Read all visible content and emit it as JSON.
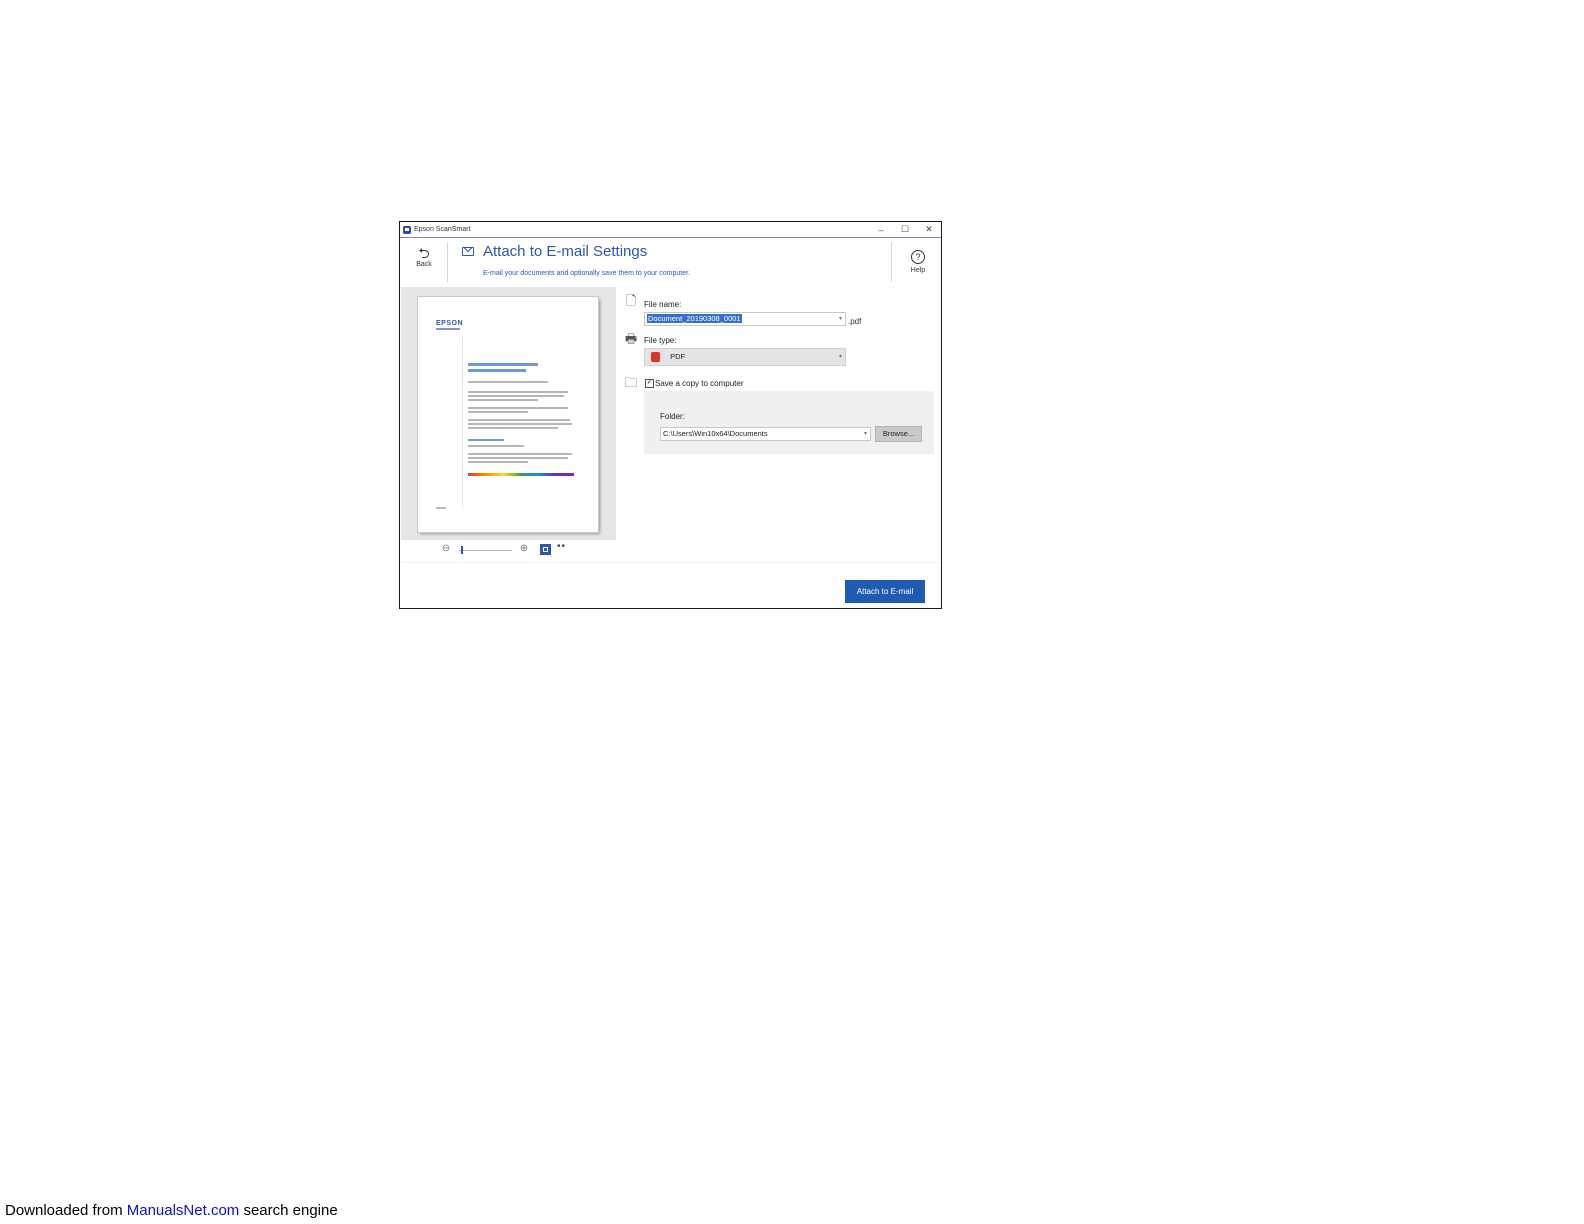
{
  "window": {
    "title": "Epson ScanSmart",
    "controls": {
      "minimize": "–",
      "maximize": "☐",
      "close": "✕"
    }
  },
  "header": {
    "back_label": "Back",
    "title": "Attach to E-mail Settings",
    "subtitle": "E-mail your documents and optionally save them to your computer.",
    "help_label": "Help"
  },
  "preview": {
    "logo": "EPSON",
    "zoom_level": 0.05
  },
  "settings": {
    "file_name_label": "File name:",
    "file_name_value": "Document_20190308_0001",
    "file_extension": ".pdf",
    "file_type_label": "File type:",
    "file_type_value": "PDF",
    "save_copy_label": "Save a copy to computer",
    "save_copy_checked": true,
    "folder_label": "Folder:",
    "folder_value": "C:\\Users\\Win10x64\\Documents",
    "browse_label": "Browse..."
  },
  "actions": {
    "attach_label": "Attach to E-mail"
  },
  "footer_note": {
    "prefix": "Downloaded from ",
    "link": "ManualsNet.com",
    "suffix": " search engine"
  },
  "colors": {
    "accent": "#2e56b0",
    "primary_button": "#1f5ab3",
    "selection": "#3a6fc8"
  }
}
